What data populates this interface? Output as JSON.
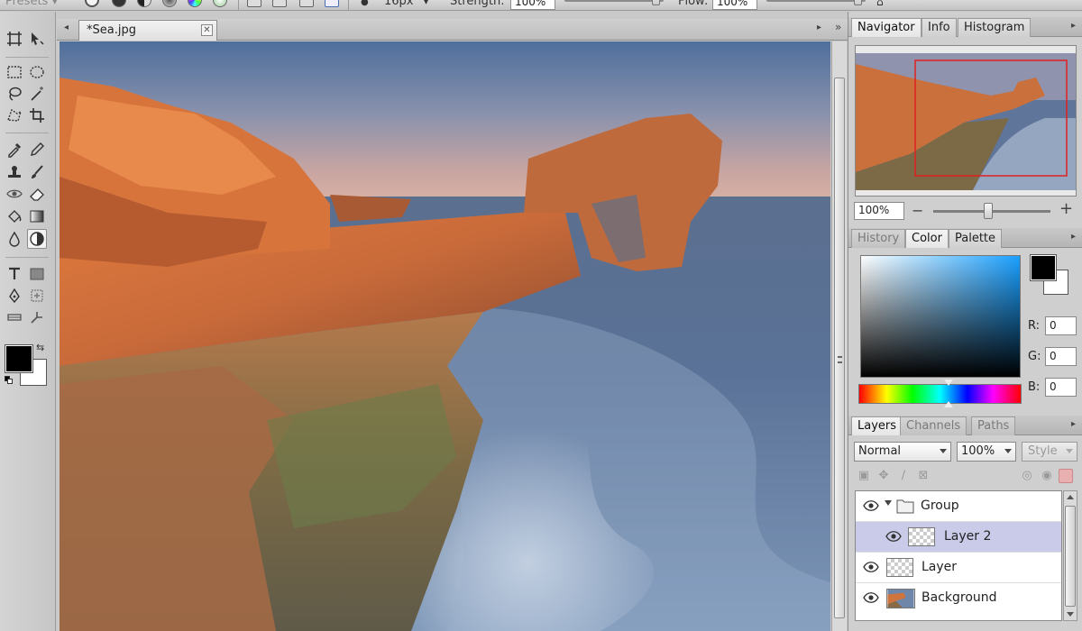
{
  "options_bar": {
    "presets_label": "Presets",
    "brush_size": "16px",
    "strength_label": "Strength:",
    "strength_value": "100%",
    "flow_label": "Flow:",
    "flow_value": "100%"
  },
  "document": {
    "tab_title": "*Sea.jpg",
    "close_glyph": "✕"
  },
  "navigator": {
    "tabs": [
      {
        "label": "Navigator",
        "active": true
      },
      {
        "label": "Info",
        "active": false
      },
      {
        "label": "Histogram",
        "active": false
      }
    ],
    "zoom_value": "100%",
    "zoom_slider_fraction": 0.5
  },
  "color_panel": {
    "tabs": [
      {
        "label": "History",
        "active": false
      },
      {
        "label": "Color",
        "active": true
      },
      {
        "label": "Palette",
        "active": false
      }
    ],
    "r_label": "R:",
    "g_label": "G:",
    "b_label": "B:",
    "r_value": "0",
    "g_value": "0",
    "b_value": "0",
    "foreground_color": "#000000",
    "background_color": "#ffffff"
  },
  "layers_panel": {
    "tabs": [
      {
        "label": "Layers",
        "active": true
      },
      {
        "label": "Channels",
        "active": false
      },
      {
        "label": "Paths",
        "active": false
      }
    ],
    "blend_mode": "Normal",
    "opacity": "100%",
    "style_label": "Style",
    "layers": [
      {
        "name": "Group",
        "type": "group",
        "selected": false
      },
      {
        "name": "Layer 2",
        "type": "layer",
        "selected": true
      },
      {
        "name": "Layer",
        "type": "layer",
        "selected": false
      },
      {
        "name": "Background",
        "type": "image",
        "selected": false
      }
    ]
  },
  "colors": {
    "selection_row": "#c9cbe8",
    "navigator_view_box": "#e02020"
  }
}
